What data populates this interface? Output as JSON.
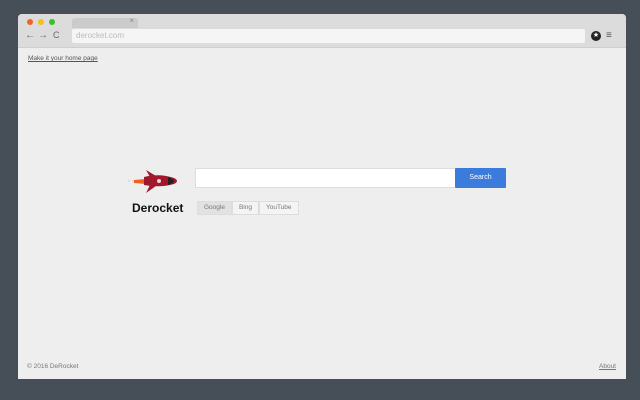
{
  "browser": {
    "url": "derocket.com",
    "tab_close": "×",
    "back": "←",
    "forward": "→",
    "reload": "C",
    "menu": "≡"
  },
  "page": {
    "home_link": "Make it your home page",
    "search_placeholder": "",
    "search_button": "Search",
    "brand": "Derocket",
    "engines": [
      {
        "label": "Google",
        "active": true
      },
      {
        "label": "Bing",
        "active": false
      },
      {
        "label": "YouTube",
        "active": false
      }
    ],
    "copyright": "© 2016 DeRocket",
    "about": "About"
  },
  "colors": {
    "accent": "#3a7bdc",
    "rocket": "#a0182c"
  }
}
